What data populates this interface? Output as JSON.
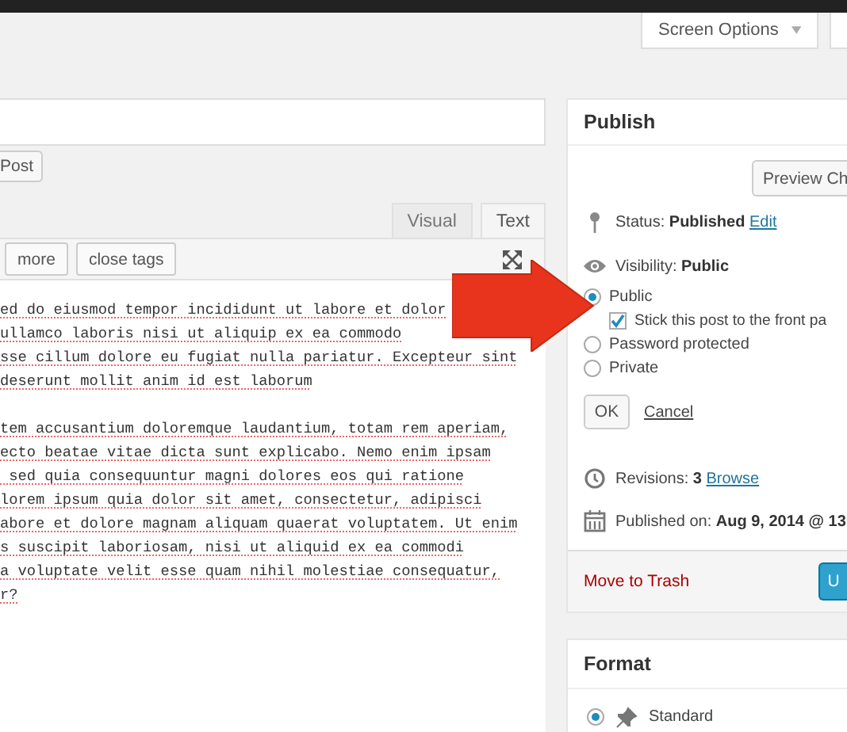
{
  "screen_options": {
    "label": "Screen Options"
  },
  "post_button": {
    "label": "Post"
  },
  "editor": {
    "tabs": [
      {
        "label": "Visual",
        "selected": false
      },
      {
        "label": "Text",
        "selected": true
      }
    ],
    "quicktags": [
      "more",
      "close tags"
    ],
    "paragraphs": [
      [
        "ed do eiusmod tempor incididunt ut labore et dolor",
        "ullamco laboris nisi ut aliquip ex ea commodo",
        "sse cillum dolore eu fugiat nulla pariatur. Excepteur sint",
        "deserunt mollit anim id est laborum"
      ],
      [
        "tem accusantium doloremque laudantium, totam rem aperiam,",
        "ecto beatae vitae dicta sunt explicabo. Nemo enim ipsam",
        " sed quia consequuntur magni dolores eos qui ratione",
        "lorem ipsum quia dolor sit amet, consectetur, adipisci",
        "abore et dolore magnam aliquam quaerat voluptatem. Ut enim",
        "s suscipit laboriosam, nisi ut aliquid ex ea commodi",
        "a voluptate velit esse quam nihil molestiae consequatur,",
        "r?"
      ]
    ]
  },
  "publish": {
    "title": "Publish",
    "preview_button": "Preview Ch",
    "status": {
      "text": "Status: **Published**",
      "link": "Edit"
    },
    "visibility": {
      "text": "Visibility: **Public**"
    },
    "visibility_options": [
      {
        "label": "Public",
        "selected": true
      },
      {
        "label": "Password protected",
        "selected": false
      },
      {
        "label": "Private",
        "selected": false
      }
    ],
    "sticky": {
      "label": "Stick this post to the front pa",
      "checked": true
    },
    "ok_button": "OK",
    "cancel_link": "Cancel",
    "revisions": {
      "text": "Revisions: **3**",
      "link": "Browse"
    },
    "published_on": {
      "text": "Published on: **Aug 9, 2014 @ 13**"
    },
    "trash_link": "Move to Trash",
    "update_button": "U"
  },
  "format": {
    "title": "Format",
    "options": [
      {
        "label": "Standard",
        "selected": true
      }
    ]
  }
}
